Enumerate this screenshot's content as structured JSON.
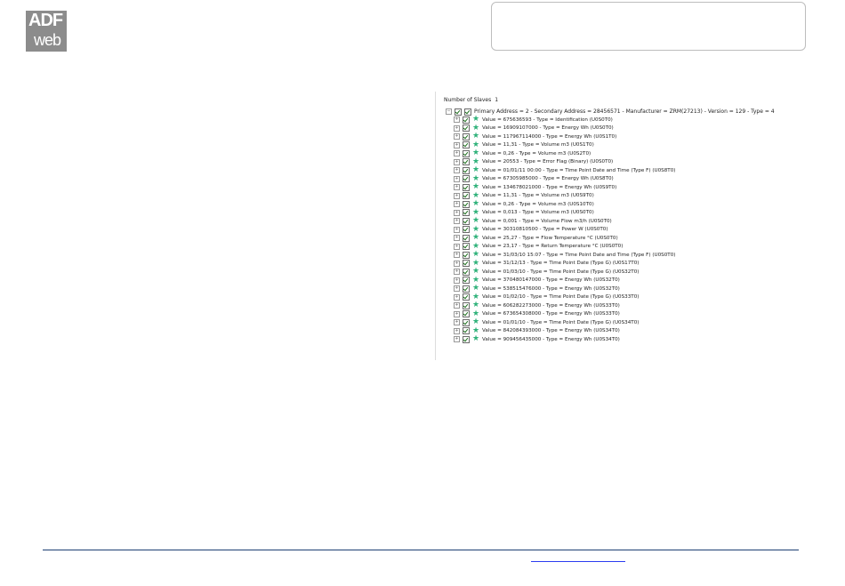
{
  "logo": {
    "line1": "ADF",
    "line2": "web"
  },
  "panel": {
    "slaves_label": "Number of Slaves",
    "slaves_count": "1",
    "primary_line": "Primary Address = 2 - Secondary Address = 28456571 - Manufacturer = ZRM(27213) - Version = 129 - Type = 4",
    "rows": [
      "Value = 675636593 - Type = Identification (U0S0T0)",
      "Value = 16909107000 - Type = Energy Wh (U0S0T0)",
      "Value = 117967114000 - Type = Energy Wh (U0S1T0)",
      "Value = 11,31 - Type = Volume m3 (U0S1T0)",
      "Value = 0,26 - Type = Volume m3 (U0S2T0)",
      "Value = 20553 - Type = Error Flag (Binary) (U0S0T0)",
      "Value = 01/01/11 00:00 - Type = Time Point Date and Time (Type F) (U0S8T0)",
      "Value = 67305985000 - Type = Energy Wh (U0S8T0)",
      "Value = 134678021000 - Type = Energy Wh (U0S9T0)",
      "Value = 11,31 - Type = Volume m3 (U0S9T0)",
      "Value = 0,26 - Type = Volume m3 (U0S10T0)",
      "Value = 0,013 - Type = Volume m3 (U0S0T0)",
      "Value = 0,001 - Type = Volume Flow m3/h (U0S0T0)",
      "Value = 30310810500 - Type = Power W (U0S0T0)",
      "Value = 25,27 - Type = Flow Temperature °C (U0S0T0)",
      "Value = 23,17 - Type = Return Temperature °C (U0S0T0)",
      "Value = 31/03/10 15:07 - Type = Time Point Date and Time (Type F) (U0S0T0)",
      "Value = 31/12/13 - Type = Time Point Date (Type G) (U0S17T0)",
      "Value = 01/03/10 - Type = Time Point Date (Type G) (U0S32T0)",
      "Value = 370480147000 - Type = Energy Wh (U0S32T0)",
      "Value = 538515476000 - Type = Energy Wh (U0S32T0)",
      "Value = 01/02/10 - Type = Time Point Date (Type G) (U0S33T0)",
      "Value = 606282273000 - Type = Energy Wh (U0S33T0)",
      "Value = 673654308000 - Type = Energy Wh (U0S33T0)",
      "Value = 01/01/10 - Type = Time Point Date (Type G) (U0S34T0)",
      "Value = 842084393000 - Type = Energy Wh (U0S34T0)",
      "Value = 909456435000 - Type = Energy Wh (U0S34T0)"
    ]
  }
}
